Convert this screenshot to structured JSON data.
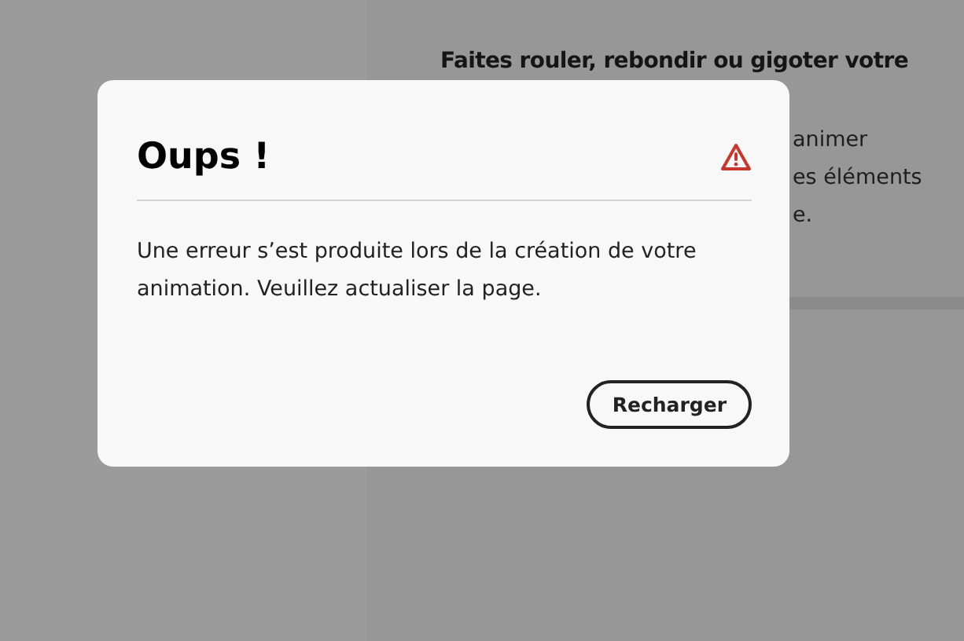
{
  "background": {
    "heading": "Faites rouler, rebondir ou gigoter votre",
    "text_lines": [
      "animer",
      "es éléments",
      "e."
    ]
  },
  "dialog": {
    "title": "Oups !",
    "message": "Une erreur s’est produite lors de la création de votre animation. Veuillez actualiser la page.",
    "buttons": [
      "Recharger"
    ]
  }
}
